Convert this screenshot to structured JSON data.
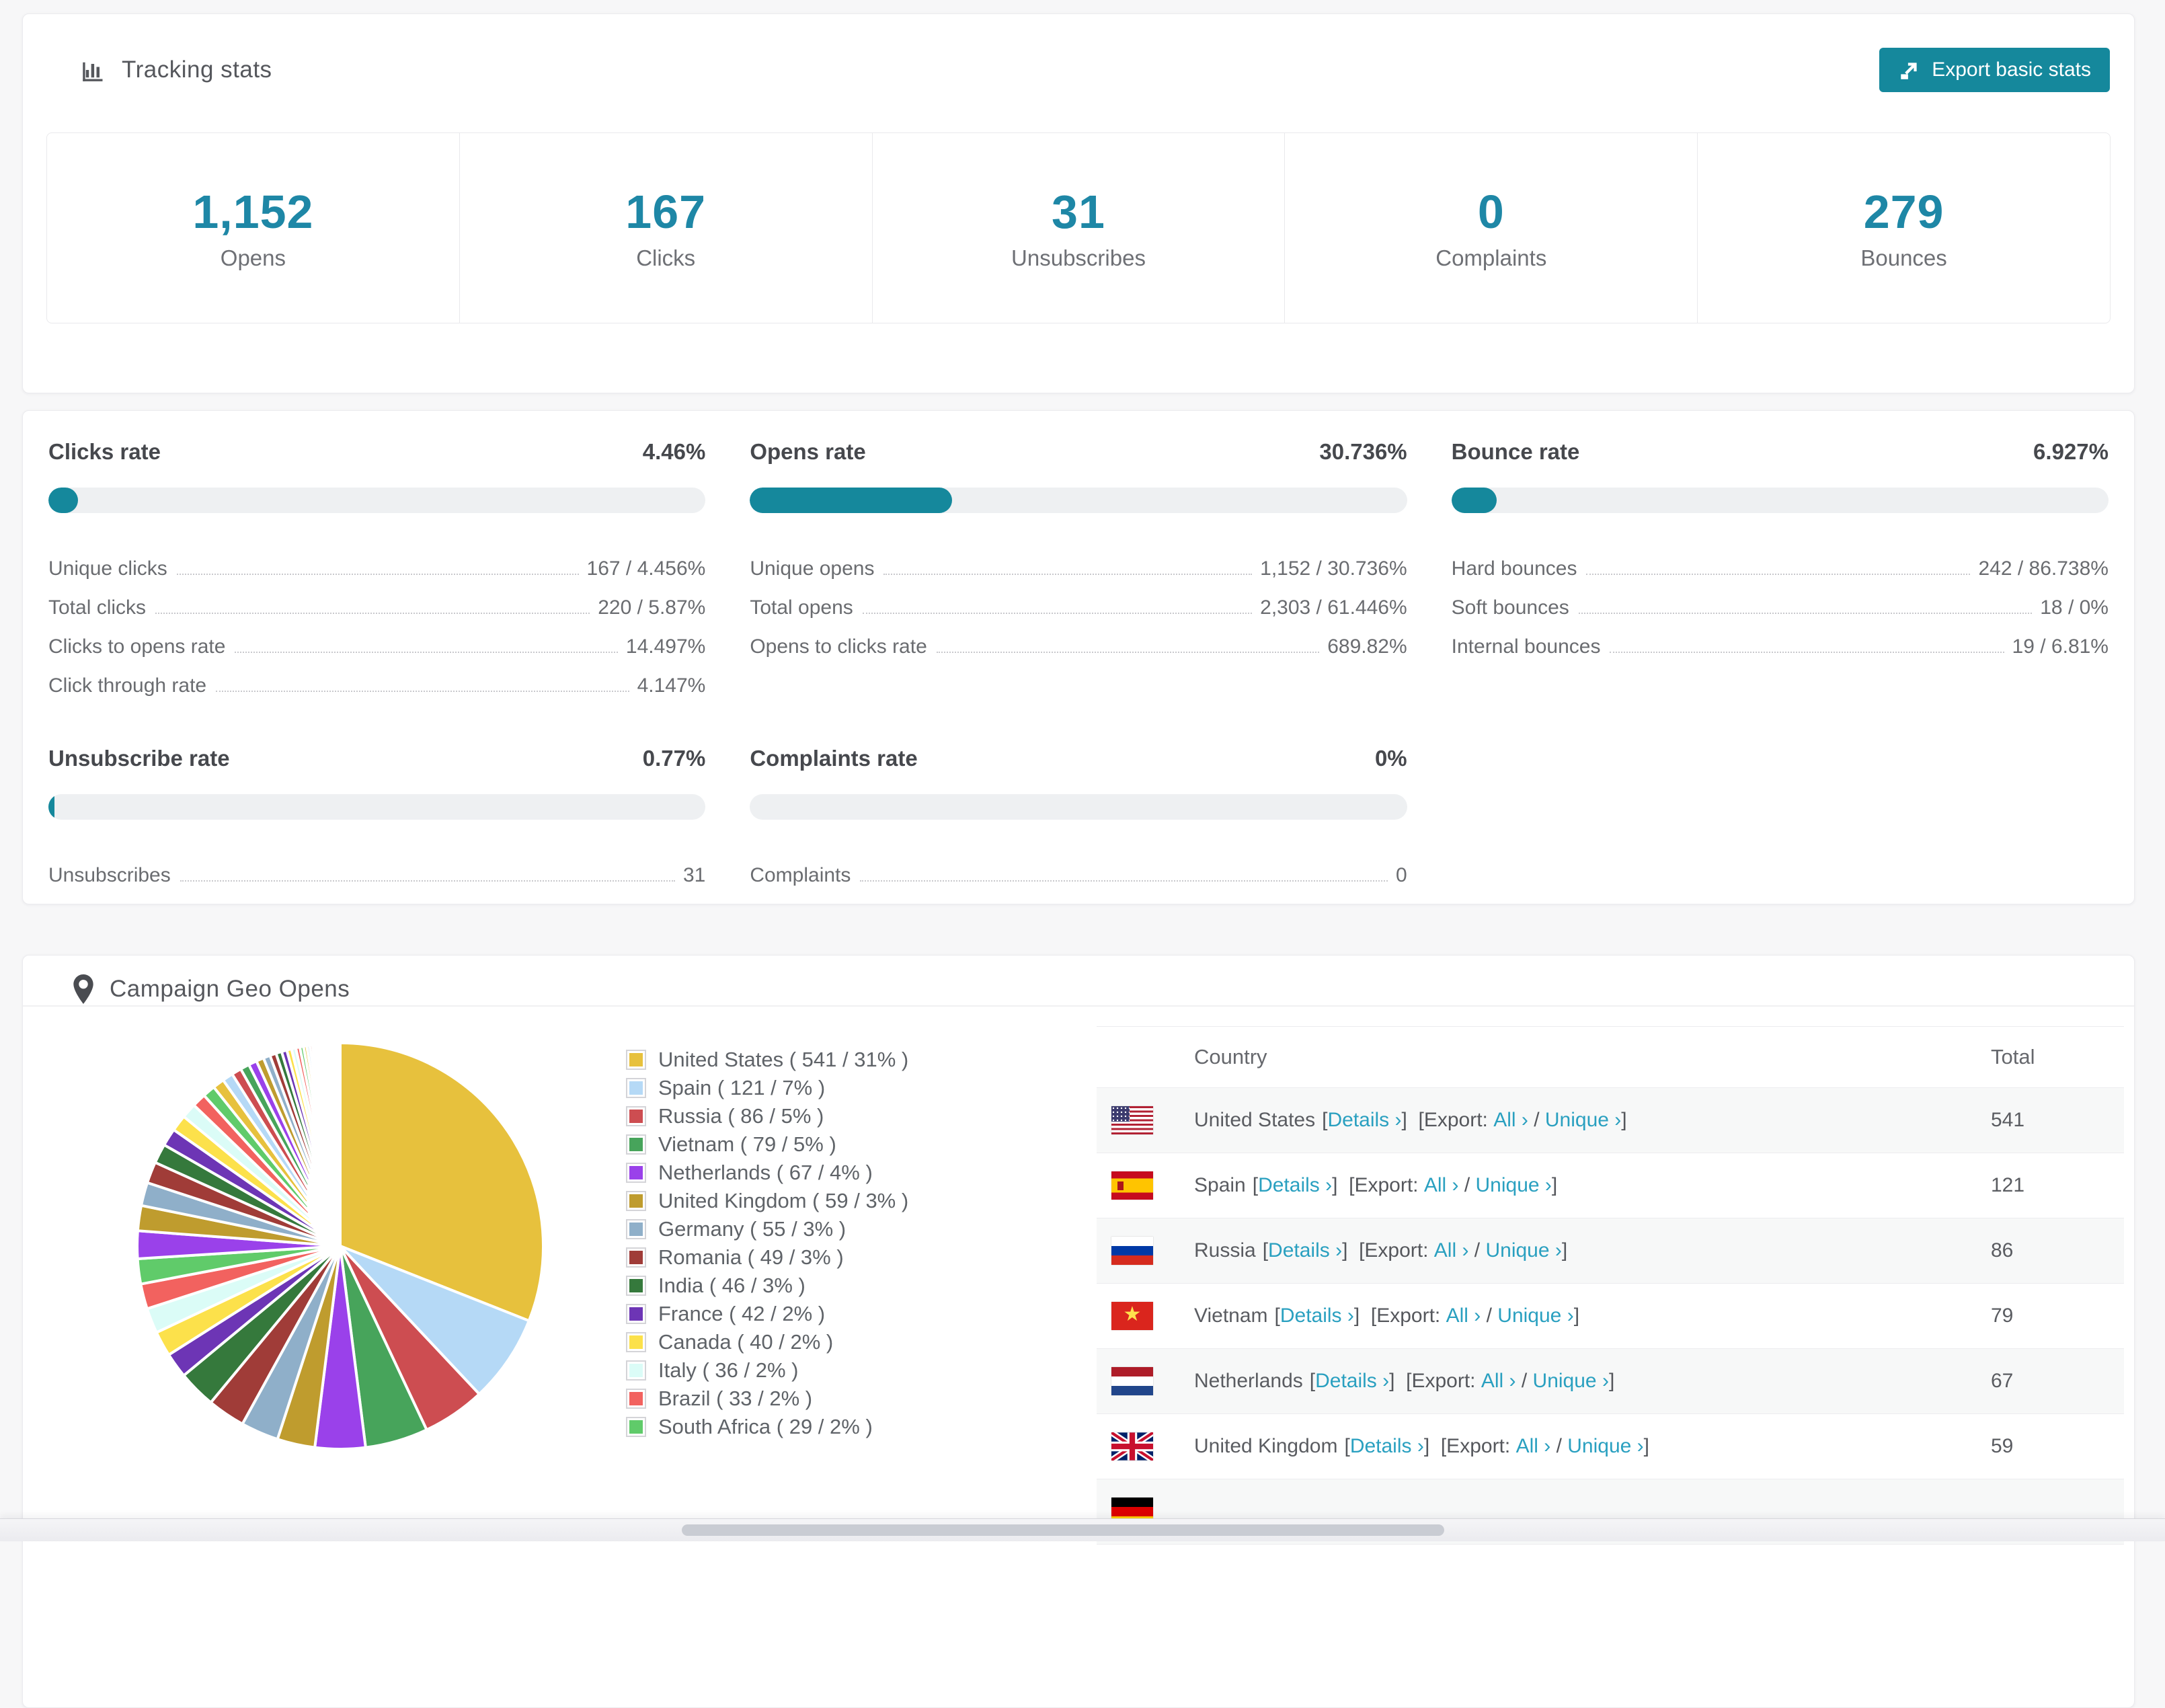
{
  "accent": "#15889c",
  "tracking": {
    "title": "Tracking stats",
    "export_label": "Export basic stats",
    "stats": [
      {
        "value": "1,152",
        "label": "Opens"
      },
      {
        "value": "167",
        "label": "Clicks"
      },
      {
        "value": "31",
        "label": "Unsubscribes"
      },
      {
        "value": "0",
        "label": "Complaints"
      },
      {
        "value": "279",
        "label": "Bounces"
      }
    ]
  },
  "rates": [
    {
      "title": "Clicks rate",
      "value": "4.46%",
      "percent": 4.46,
      "rows": [
        {
          "label": "Unique clicks",
          "value": "167 / 4.456%"
        },
        {
          "label": "Total clicks",
          "value": "220 / 5.87%"
        },
        {
          "label": "Clicks to opens rate",
          "value": "14.497%"
        },
        {
          "label": "Click through rate",
          "value": "4.147%"
        }
      ]
    },
    {
      "title": "Opens rate",
      "value": "30.736%",
      "percent": 30.736,
      "rows": [
        {
          "label": "Unique opens",
          "value": "1,152 / 30.736%"
        },
        {
          "label": "Total opens",
          "value": "2,303 / 61.446%"
        },
        {
          "label": "Opens to clicks rate",
          "value": "689.82%"
        }
      ]
    },
    {
      "title": "Bounce rate",
      "value": "6.927%",
      "percent": 6.927,
      "rows": [
        {
          "label": "Hard bounces",
          "value": "242 / 86.738%"
        },
        {
          "label": "Soft bounces",
          "value": "18 / 0%"
        },
        {
          "label": "Internal bounces",
          "value": "19 / 6.81%"
        }
      ]
    },
    {
      "title": "Unsubscribe rate",
      "value": "0.77%",
      "percent": 0.77,
      "rows": [
        {
          "label": "Unsubscribes",
          "value": "31"
        }
      ]
    },
    {
      "title": "Complaints rate",
      "value": "0%",
      "percent": 0,
      "rows": [
        {
          "label": "Complaints",
          "value": "0"
        }
      ]
    }
  ],
  "geo": {
    "title": "Campaign Geo Opens",
    "table": {
      "headers": [
        "Country",
        "Total"
      ],
      "link_details": "Details",
      "link_export_prefix": "Export:",
      "link_all": "All",
      "link_unique": "Unique",
      "chevron": "›",
      "rows": [
        {
          "flag": "us",
          "country": "United States",
          "total": "541"
        },
        {
          "flag": "es",
          "country": "Spain",
          "total": "121"
        },
        {
          "flag": "ru",
          "country": "Russia",
          "total": "86"
        },
        {
          "flag": "vn",
          "country": "Vietnam",
          "total": "79"
        },
        {
          "flag": "nl",
          "country": "Netherlands",
          "total": "67"
        },
        {
          "flag": "gb",
          "country": "United Kingdom",
          "total": "59"
        },
        {
          "flag": "de",
          "country": "",
          "total": "",
          "partial": true
        }
      ]
    }
  },
  "chart_data": {
    "type": "pie",
    "title": "Campaign Geo Opens",
    "legend_position": "right",
    "slices": [
      {
        "label": "United States",
        "value": 541,
        "pct": 31,
        "color": "#e7c13d"
      },
      {
        "label": "Spain",
        "value": 121,
        "pct": 7,
        "color": "#b5d9f6"
      },
      {
        "label": "Russia",
        "value": 86,
        "pct": 5,
        "color": "#cd4d51"
      },
      {
        "label": "Vietnam",
        "value": 79,
        "pct": 5,
        "color": "#47a45b"
      },
      {
        "label": "Netherlands",
        "value": 67,
        "pct": 4,
        "color": "#9a41ea"
      },
      {
        "label": "United Kingdom",
        "value": 59,
        "pct": 3,
        "color": "#bf9c2e"
      },
      {
        "label": "Germany",
        "value": 55,
        "pct": 3,
        "color": "#8fafc9"
      },
      {
        "label": "Romania",
        "value": 49,
        "pct": 3,
        "color": "#a03c38"
      },
      {
        "label": "India",
        "value": 46,
        "pct": 3,
        "color": "#35793c"
      },
      {
        "label": "France",
        "value": 42,
        "pct": 2,
        "color": "#6d35b5"
      },
      {
        "label": "Canada",
        "value": 40,
        "pct": 2,
        "color": "#fce14b"
      },
      {
        "label": "Italy",
        "value": 36,
        "pct": 2,
        "color": "#dbfcf7"
      },
      {
        "label": "Brazil",
        "value": 33,
        "pct": 2,
        "color": "#f2625f"
      },
      {
        "label": "South Africa",
        "value": 29,
        "pct": 2,
        "color": "#60cb6a"
      }
    ],
    "other_slices_pct": [
      2.2,
      2.0,
      1.85,
      1.7,
      1.55,
      1.4,
      1.3,
      1.2,
      1.1,
      1.0,
      0.92,
      0.85,
      0.78,
      0.72,
      0.66,
      0.6,
      0.55,
      0.5,
      0.46,
      0.42,
      0.38,
      0.35,
      0.32,
      0.29,
      0.26,
      0.24,
      0.22,
      0.2,
      0.18,
      0.16,
      0.14,
      0.12,
      0.1,
      0.09,
      0.08,
      0.07
    ]
  }
}
